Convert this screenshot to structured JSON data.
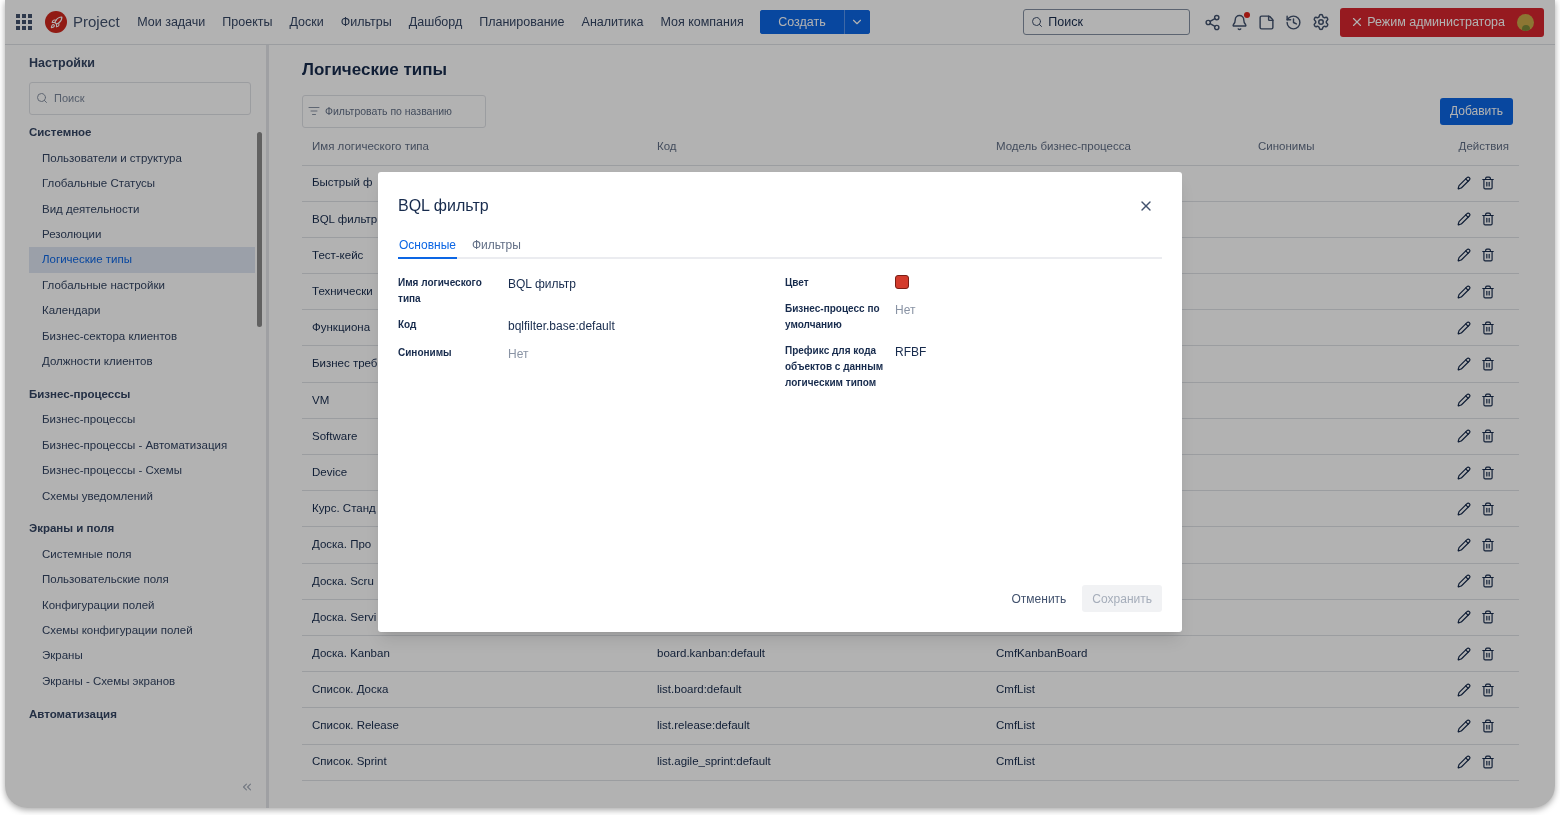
{
  "topbar": {
    "brand": "Project",
    "nav": [
      "Мои задачи",
      "Проекты",
      "Доски",
      "Фильтры",
      "Дашборд",
      "Планирование",
      "Аналитика",
      "Моя компания"
    ],
    "create_button": "Создать",
    "search": {
      "placeholder": "Поиск"
    },
    "notification": true,
    "admin_button": "Режим администратора"
  },
  "sidebar": {
    "title": "Настройки",
    "search": {
      "placeholder": "Поиск"
    },
    "sections": [
      {
        "title": "Системное",
        "items": [
          {
            "label": "Пользователи и структура",
            "selected": false
          },
          {
            "label": "Глобальные Статусы",
            "selected": false
          },
          {
            "label": "Вид деятельности",
            "selected": false
          },
          {
            "label": "Резолюции",
            "selected": false
          },
          {
            "label": "Логические типы",
            "selected": true
          },
          {
            "label": "Глобальные настройки",
            "selected": false
          },
          {
            "label": "Календари",
            "selected": false
          },
          {
            "label": "Бизнес-сектора клиентов",
            "selected": false
          },
          {
            "label": "Должности клиентов",
            "selected": false
          }
        ]
      },
      {
        "title": "Бизнес-процессы",
        "items": [
          {
            "label": "Бизнес-процессы",
            "selected": false
          },
          {
            "label": "Бизнес-процессы - Автоматизация",
            "selected": false
          },
          {
            "label": "Бизнес-процессы - Схемы",
            "selected": false
          },
          {
            "label": "Схемы уведомлений",
            "selected": false
          }
        ]
      },
      {
        "title": "Экраны и поля",
        "items": [
          {
            "label": "Системные поля",
            "selected": false
          },
          {
            "label": "Пользовательские поля",
            "selected": false
          },
          {
            "label": "Конфигурации полей",
            "selected": false
          },
          {
            "label": "Схемы конфигурации полей",
            "selected": false
          },
          {
            "label": "Экраны",
            "selected": false
          },
          {
            "label": "Экраны - Схемы экранов",
            "selected": false
          }
        ]
      },
      {
        "title": "Автоматизация"
      }
    ]
  },
  "page": {
    "title": "Логические типы",
    "filter": {
      "placeholder": "Фильтровать по названию"
    },
    "add_button": "Добавить",
    "table": {
      "columns": [
        "Имя логического типа",
        "Код",
        "Модель бизнес-процесса",
        "Синонимы",
        "Действия"
      ],
      "rows": [
        {
          "name": "Быстрый ф"
        },
        {
          "name": "BQL фильтр"
        },
        {
          "name": "Тест-кейс"
        },
        {
          "name": "Технически"
        },
        {
          "name": "Функциона"
        },
        {
          "name": "Бизнес треб"
        },
        {
          "name": "VM"
        },
        {
          "name": "Software"
        },
        {
          "name": "Device"
        },
        {
          "name": "Курс. Станд"
        },
        {
          "name": "Доска. Про"
        },
        {
          "name": "Доска. Scru"
        },
        {
          "name": "Доска. Servi"
        },
        {
          "name": "Доска. Kanban",
          "code": "board.kanban:default",
          "model": "CmfKanbanBoard"
        },
        {
          "name": "Список. Доска",
          "code": "list.board:default",
          "model": "CmfList"
        },
        {
          "name": "Список. Release",
          "code": "list.release:default",
          "model": "CmfList"
        },
        {
          "name": "Список. Sprint",
          "code": "list.agile_sprint:default",
          "model": "CmfList"
        }
      ]
    }
  },
  "dialog": {
    "title": "BQL фильтр",
    "tabs": [
      {
        "label": "Основные",
        "selected": true
      },
      {
        "label": "Фильтры",
        "selected": false
      }
    ],
    "left_fields": [
      {
        "label": "Имя логического типа",
        "kind": "text",
        "value": "BQL фильтр"
      },
      {
        "label": "Код",
        "kind": "text",
        "value": "bqlfilter.base:default"
      },
      {
        "label": "Синонимы",
        "kind": "empty",
        "value": "Нет"
      }
    ],
    "right_fields": [
      {
        "label": "Цвет",
        "kind": "color",
        "color": "#d33b2c"
      },
      {
        "label": "Бизнес-процесс по умолчанию",
        "kind": "empty",
        "value": "Нет"
      },
      {
        "label": "Префикс для кода объектов с данным логическим типом",
        "kind": "text",
        "value": "RFBF"
      }
    ],
    "cancel_button": "Отменить",
    "save_button": {
      "label": "Сохранить",
      "disabled": true
    }
  }
}
